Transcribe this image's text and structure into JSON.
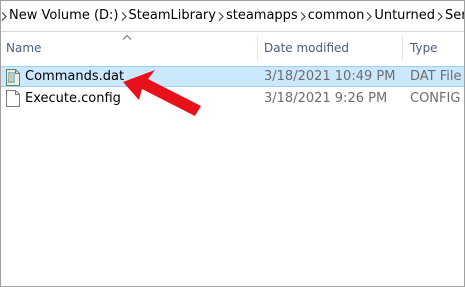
{
  "breadcrumb": {
    "items": [
      "New Volume (D:)",
      "SteamLibrary",
      "steamapps",
      "common",
      "Unturned",
      "Ser"
    ]
  },
  "columns": {
    "name": "Name",
    "date_modified": "Date modified",
    "type": "Type"
  },
  "files": [
    {
      "name": "Commands.dat",
      "date_modified": "3/18/2021 10:49 PM",
      "type": "DAT File",
      "selected": true,
      "icon": "dat-file-icon"
    },
    {
      "name": "Execute.config",
      "date_modified": "3/18/2021 9:26 PM",
      "type": "CONFIG Fi",
      "selected": false,
      "icon": "document-file-icon"
    }
  ],
  "colors": {
    "selection_fill": "#cce8ff",
    "selection_border": "#99d1ff",
    "header_text": "#4c607a",
    "annotation_arrow": "#e8101a"
  }
}
